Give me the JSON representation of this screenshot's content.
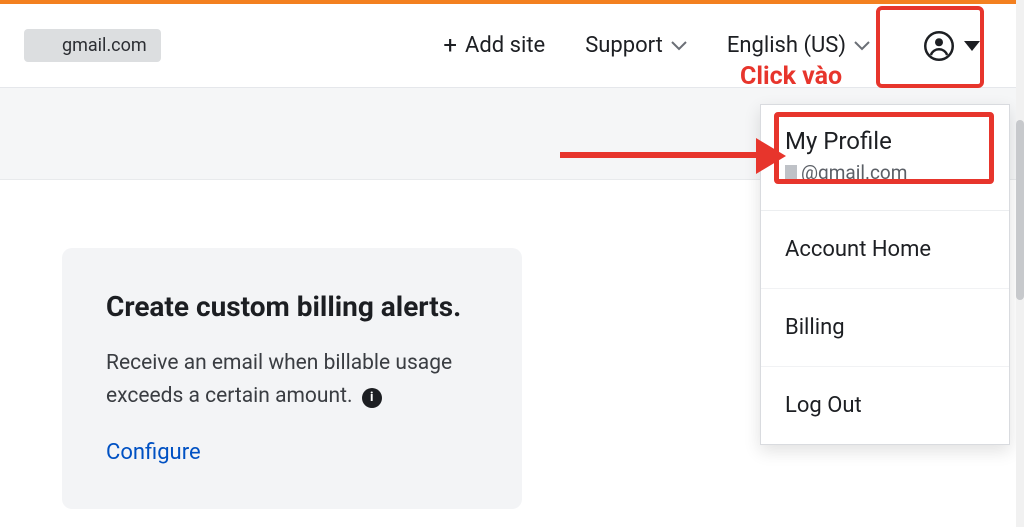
{
  "header": {
    "account_email_suffix": "gmail.com",
    "add_site_label": "Add site",
    "support_label": "Support",
    "language_label": "English (US)"
  },
  "annotation": {
    "click_label": "Click vào"
  },
  "menu": {
    "my_profile_label": "My Profile",
    "my_profile_email": "@gmail.com",
    "account_home_label": "Account Home",
    "billing_label": "Billing",
    "log_out_label": "Log Out"
  },
  "card": {
    "title": "Create custom billing alerts.",
    "body_line1": "Receive an email when billable usage",
    "body_line2": "exceeds a certain amount.",
    "configure_label": "Configure"
  }
}
